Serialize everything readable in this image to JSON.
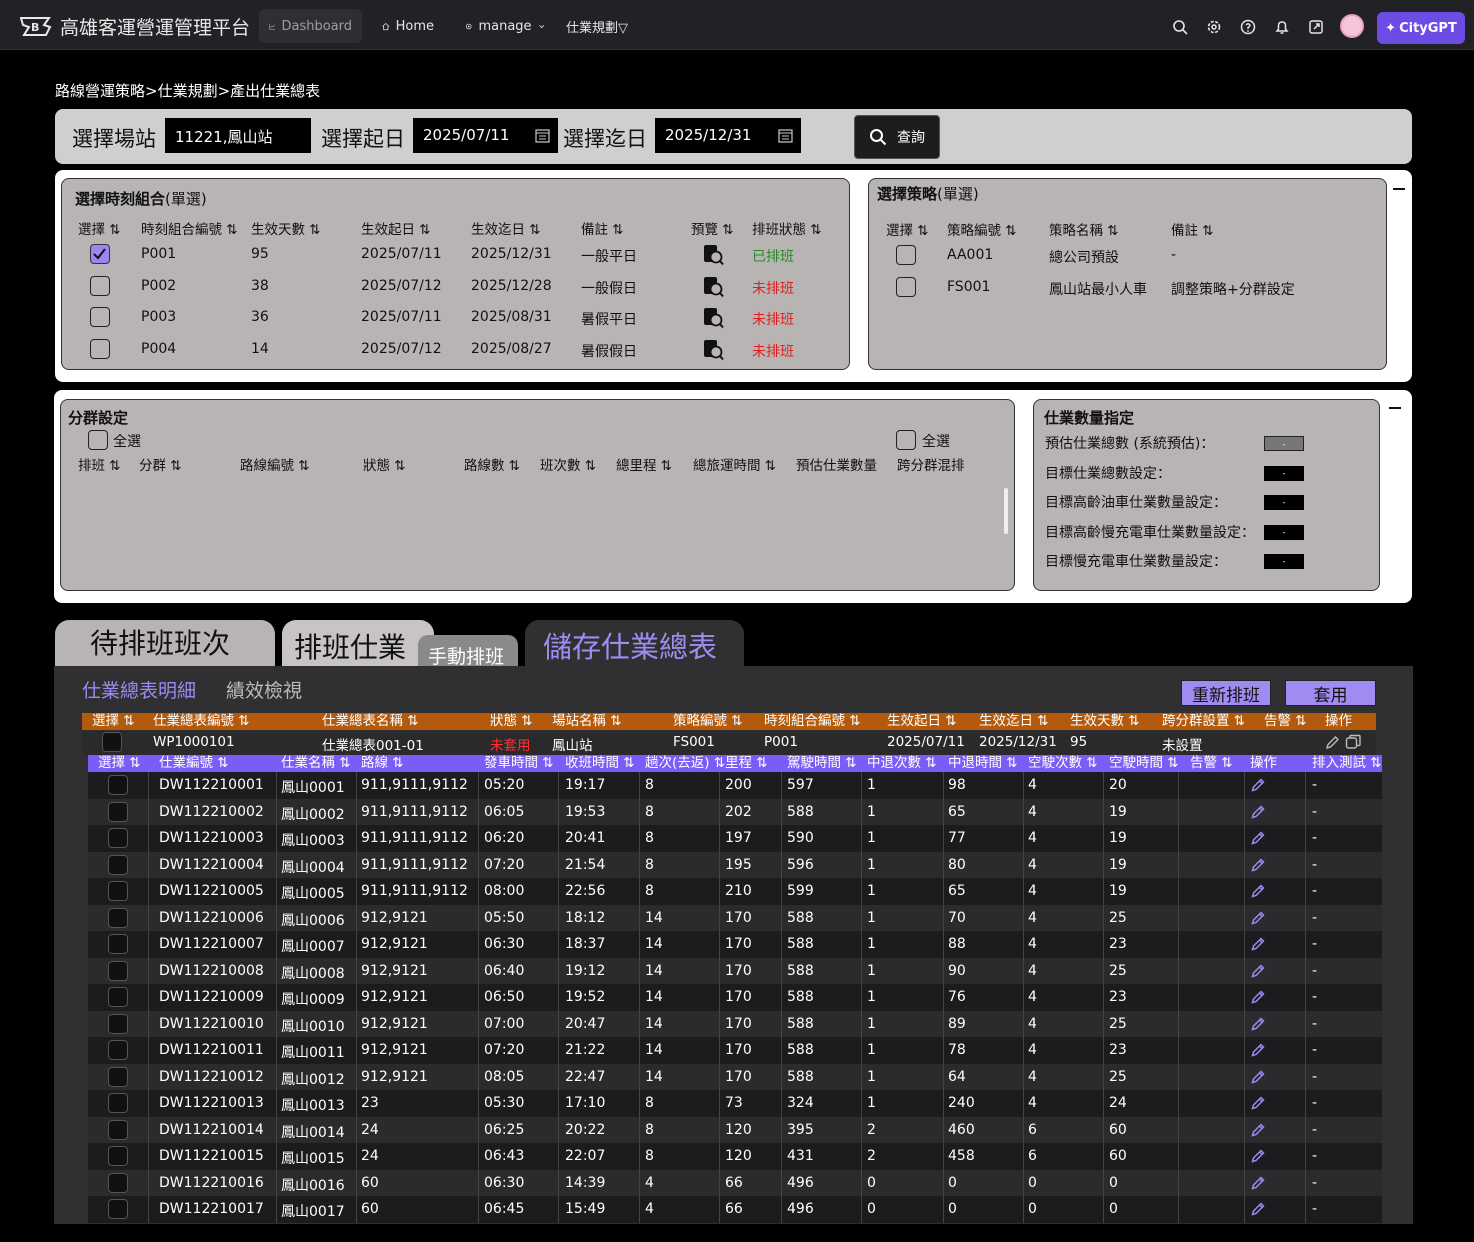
{
  "app": {
    "title": "高雄客運營運管理平台",
    "nav": {
      "dashboard": "Dashboard",
      "home": "Home",
      "manage": "manage",
      "plan": "仕業規劃▽"
    },
    "citygpt": "CityGPT"
  },
  "breadcrumb": "路線營運策略>仕業規劃>產出仕業總表",
  "filters": {
    "station_label": "選擇場站",
    "station_value": "11221,鳳山站",
    "start_label": "選擇起日",
    "start_value": "2025/07/11",
    "end_label": "選擇迄日",
    "end_value": "2025/12/31",
    "query_label": "查詢"
  },
  "timeset": {
    "title": "選擇時刻組合",
    "title_suffix": "(單選)",
    "headers": [
      "選擇 ⇅",
      "時刻組合編號 ⇅",
      "生效天數 ⇅",
      "生效起日 ⇅",
      "生效迄日 ⇅",
      "備註 ⇅",
      "預覽 ⇅",
      "排班狀態 ⇅"
    ],
    "rows": [
      {
        "checked": true,
        "id": "P001",
        "days": "95",
        "start": "2025/07/11",
        "end": "2025/12/31",
        "note": "一般平日",
        "status": "已排班",
        "status_type": "done"
      },
      {
        "checked": false,
        "id": "P002",
        "days": "38",
        "start": "2025/07/12",
        "end": "2025/12/28",
        "note": "一般假日",
        "status": "未排班",
        "status_type": "todo"
      },
      {
        "checked": false,
        "id": "P003",
        "days": "36",
        "start": "2025/07/11",
        "end": "2025/08/31",
        "note": "暑假平日",
        "status": "未排班",
        "status_type": "todo"
      },
      {
        "checked": false,
        "id": "P004",
        "days": "14",
        "start": "2025/07/12",
        "end": "2025/08/27",
        "note": "暑假假日",
        "status": "未排班",
        "status_type": "todo"
      }
    ]
  },
  "strategy": {
    "title": "選擇策略",
    "title_suffix": "(單選)",
    "headers": [
      "選擇 ⇅",
      "策略編號 ⇅",
      "策略名稱 ⇅",
      "備註 ⇅"
    ],
    "rows": [
      {
        "id": "AA001",
        "name": "總公司預設",
        "note": "-"
      },
      {
        "id": "FS001",
        "name": "鳳山站最小人車",
        "note": "調整策略+分群設定"
      }
    ]
  },
  "grouping": {
    "title": "分群設定",
    "select_all": "全選",
    "select_all2": "全選",
    "headers": [
      "排班 ⇅",
      "分群 ⇅",
      "路線編號 ⇅",
      "狀態 ⇅",
      "路線數 ⇅",
      "班次數 ⇅",
      "總里程 ⇅",
      "總旅運時間 ⇅",
      "預估仕業數量",
      "跨分群混排"
    ]
  },
  "quantity": {
    "title": "仕業數量指定",
    "rows": [
      {
        "label": "預估仕業總數 (系統預估)：",
        "value": "-"
      },
      {
        "label": "目標仕業總數設定：",
        "value": "-"
      },
      {
        "label": "目標高齡油車仕業數量設定：",
        "value": "-"
      },
      {
        "label": "目標高齡慢充電車仕業數量設定：",
        "value": "-"
      },
      {
        "label": "目標慢充電車仕業數量設定：",
        "value": "-"
      }
    ]
  },
  "tabs": {
    "pending": "待排班班次",
    "schedule": "排班仕業",
    "manual": "手動排班",
    "save": "儲存仕業總表"
  },
  "subtabs": {
    "detail": "仕業總表明細",
    "review": "績效檢視"
  },
  "actions": {
    "reschedule": "重新排班",
    "apply": "套用"
  },
  "summary": {
    "headers": [
      "選擇 ⇅",
      "仕業總表編號 ⇅",
      "仕業總表名稱 ⇅",
      "狀態 ⇅",
      "場站名稱 ⇅",
      "策略編號 ⇅",
      "時刻組合編號 ⇅",
      "生效起日 ⇅",
      "生效迄日 ⇅",
      "生效天數 ⇅",
      "跨分群設置 ⇅",
      "告警 ⇅",
      "操作"
    ],
    "row": {
      "id": "WP1000101",
      "name": "仕業總表001-01",
      "status": "未套用",
      "station": "鳳山站",
      "strategy": "FS001",
      "timeset": "P001",
      "start": "2025/07/11",
      "end": "2025/12/31",
      "days": "95",
      "cross": "未設置"
    }
  },
  "detail": {
    "headers": [
      "選擇 ⇅",
      "仕業編號 ⇅",
      "仕業名稱 ⇅",
      "路線 ⇅",
      "發車時間 ⇅",
      "收班時間 ⇅",
      "趟次(去返) ⇅",
      "里程 ⇅",
      "駕駛時間 ⇅",
      "中退次數 ⇅",
      "中退時間 ⇅",
      "空駛次數 ⇅",
      "空駛時間 ⇅",
      "告警 ⇅",
      "操作",
      "排入測試 ⇅"
    ],
    "rows": [
      [
        "DW112210001",
        "鳳山0001",
        "911,9111,9112",
        "05:20",
        "19:17",
        "8",
        "200",
        "597",
        "1",
        "98",
        "4",
        "20",
        "-"
      ],
      [
        "DW112210002",
        "鳳山0002",
        "911,9111,9112",
        "06:05",
        "19:53",
        "8",
        "202",
        "588",
        "1",
        "65",
        "4",
        "19",
        "-"
      ],
      [
        "DW112210003",
        "鳳山0003",
        "911,9111,9112",
        "06:20",
        "20:41",
        "8",
        "197",
        "590",
        "1",
        "77",
        "4",
        "19",
        "-"
      ],
      [
        "DW112210004",
        "鳳山0004",
        "911,9111,9112",
        "07:20",
        "21:54",
        "8",
        "195",
        "596",
        "1",
        "80",
        "4",
        "19",
        "-"
      ],
      [
        "DW112210005",
        "鳳山0005",
        "911,9111,9112",
        "08:00",
        "22:56",
        "8",
        "210",
        "599",
        "1",
        "65",
        "4",
        "19",
        "-"
      ],
      [
        "DW112210006",
        "鳳山0006",
        "912,9121",
        "05:50",
        "18:12",
        "14",
        "170",
        "588",
        "1",
        "70",
        "4",
        "25",
        "-"
      ],
      [
        "DW112210007",
        "鳳山0007",
        "912,9121",
        "06:30",
        "18:37",
        "14",
        "170",
        "588",
        "1",
        "88",
        "4",
        "23",
        "-"
      ],
      [
        "DW112210008",
        "鳳山0008",
        "912,9121",
        "06:40",
        "19:12",
        "14",
        "170",
        "588",
        "1",
        "90",
        "4",
        "25",
        "-"
      ],
      [
        "DW112210009",
        "鳳山0009",
        "912,9121",
        "06:50",
        "19:52",
        "14",
        "170",
        "588",
        "1",
        "76",
        "4",
        "23",
        "-"
      ],
      [
        "DW112210010",
        "鳳山0010",
        "912,9121",
        "07:00",
        "20:47",
        "14",
        "170",
        "588",
        "1",
        "89",
        "4",
        "25",
        "-"
      ],
      [
        "DW112210011",
        "鳳山0011",
        "912,9121",
        "07:20",
        "21:22",
        "14",
        "170",
        "588",
        "1",
        "78",
        "4",
        "23",
        "-"
      ],
      [
        "DW112210012",
        "鳳山0012",
        "912,9121",
        "08:05",
        "22:47",
        "14",
        "170",
        "588",
        "1",
        "64",
        "4",
        "25",
        "-"
      ],
      [
        "DW112210013",
        "鳳山0013",
        "23",
        "05:30",
        "17:10",
        "8",
        "73",
        "324",
        "1",
        "240",
        "4",
        "24",
        "-"
      ],
      [
        "DW112210014",
        "鳳山0014",
        "24",
        "06:25",
        "20:22",
        "8",
        "120",
        "395",
        "2",
        "460",
        "6",
        "60",
        "-"
      ],
      [
        "DW112210015",
        "鳳山0015",
        "24",
        "06:43",
        "22:07",
        "8",
        "120",
        "431",
        "2",
        "458",
        "6",
        "60",
        "-"
      ],
      [
        "DW112210016",
        "鳳山0016",
        "60",
        "06:30",
        "14:39",
        "4",
        "66",
        "496",
        "0",
        "0",
        "0",
        "0",
        "-"
      ],
      [
        "DW112210017",
        "鳳山0017",
        "60",
        "06:45",
        "15:49",
        "4",
        "66",
        "496",
        "0",
        "0",
        "0",
        "0",
        "-"
      ]
    ]
  },
  "colors": {
    "accent": "#7b5cf6",
    "orange_header": "#b45a0c",
    "green": "#2a8a2a",
    "red": "#e02020"
  }
}
